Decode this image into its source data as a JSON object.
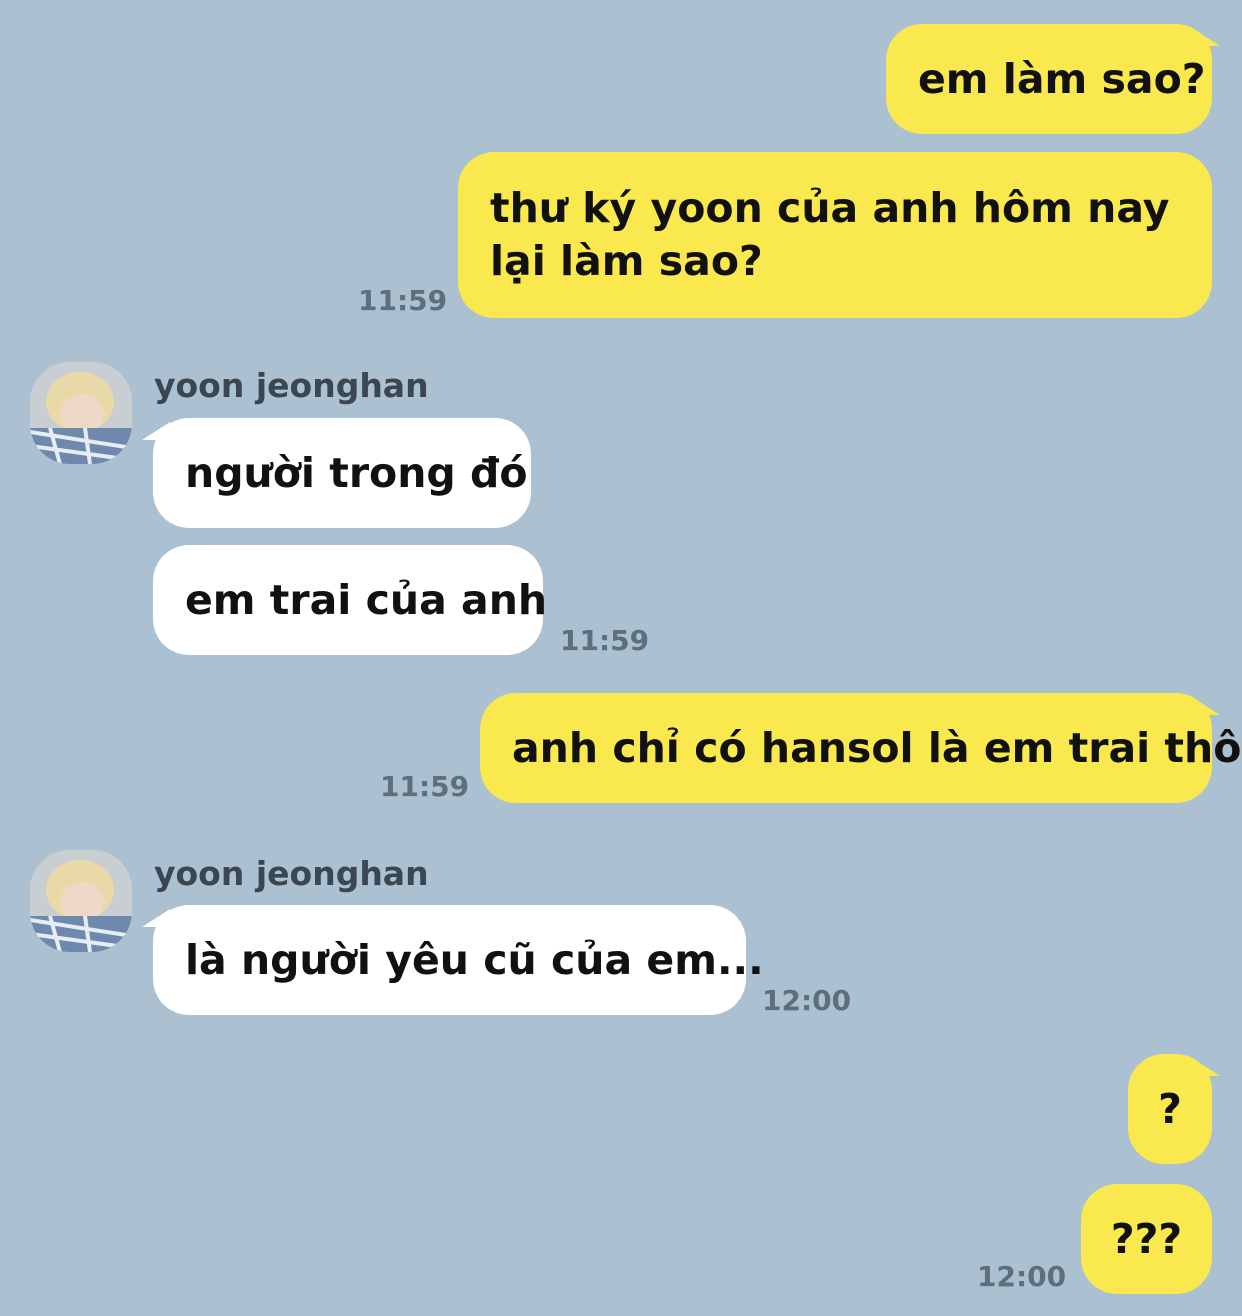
{
  "chat": {
    "contact_name": "yoon jeonghan",
    "messages": [
      {
        "text": "em làm sao?"
      },
      {
        "text": "thư ký yoon của anh hôm nay lại làm sao?",
        "time": "11:59"
      },
      {
        "text": "người trong đó"
      },
      {
        "text": "em trai của anh",
        "time": "11:59"
      },
      {
        "text": "anh chỉ có hansol là em trai thôi",
        "time": "11:59"
      },
      {
        "text": "là người yêu cũ của em...",
        "time": "12:00"
      },
      {
        "text": "?"
      },
      {
        "text": "???",
        "time": "12:00"
      }
    ]
  },
  "colors": {
    "background": "#abc1d1",
    "my_bubble": "#fae84f",
    "their_bubble": "#ffffff"
  },
  "icons": {
    "avatar": "avatar-photo"
  }
}
